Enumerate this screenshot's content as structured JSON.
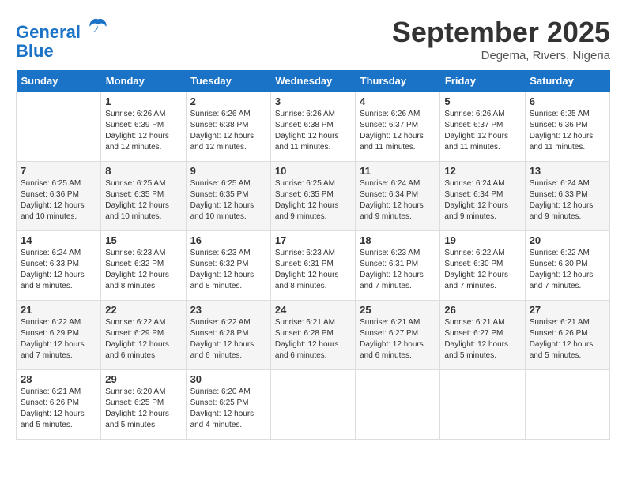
{
  "header": {
    "logo_line1": "General",
    "logo_line2": "Blue",
    "month": "September 2025",
    "location": "Degema, Rivers, Nigeria"
  },
  "days_of_week": [
    "Sunday",
    "Monday",
    "Tuesday",
    "Wednesday",
    "Thursday",
    "Friday",
    "Saturday"
  ],
  "weeks": [
    [
      {
        "day": "",
        "info": ""
      },
      {
        "day": "1",
        "info": "Sunrise: 6:26 AM\nSunset: 6:39 PM\nDaylight: 12 hours\nand 12 minutes."
      },
      {
        "day": "2",
        "info": "Sunrise: 6:26 AM\nSunset: 6:38 PM\nDaylight: 12 hours\nand 12 minutes."
      },
      {
        "day": "3",
        "info": "Sunrise: 6:26 AM\nSunset: 6:38 PM\nDaylight: 12 hours\nand 11 minutes."
      },
      {
        "day": "4",
        "info": "Sunrise: 6:26 AM\nSunset: 6:37 PM\nDaylight: 12 hours\nand 11 minutes."
      },
      {
        "day": "5",
        "info": "Sunrise: 6:26 AM\nSunset: 6:37 PM\nDaylight: 12 hours\nand 11 minutes."
      },
      {
        "day": "6",
        "info": "Sunrise: 6:25 AM\nSunset: 6:36 PM\nDaylight: 12 hours\nand 11 minutes."
      }
    ],
    [
      {
        "day": "7",
        "info": "Sunrise: 6:25 AM\nSunset: 6:36 PM\nDaylight: 12 hours\nand 10 minutes."
      },
      {
        "day": "8",
        "info": "Sunrise: 6:25 AM\nSunset: 6:35 PM\nDaylight: 12 hours\nand 10 minutes."
      },
      {
        "day": "9",
        "info": "Sunrise: 6:25 AM\nSunset: 6:35 PM\nDaylight: 12 hours\nand 10 minutes."
      },
      {
        "day": "10",
        "info": "Sunrise: 6:25 AM\nSunset: 6:35 PM\nDaylight: 12 hours\nand 9 minutes."
      },
      {
        "day": "11",
        "info": "Sunrise: 6:24 AM\nSunset: 6:34 PM\nDaylight: 12 hours\nand 9 minutes."
      },
      {
        "day": "12",
        "info": "Sunrise: 6:24 AM\nSunset: 6:34 PM\nDaylight: 12 hours\nand 9 minutes."
      },
      {
        "day": "13",
        "info": "Sunrise: 6:24 AM\nSunset: 6:33 PM\nDaylight: 12 hours\nand 9 minutes."
      }
    ],
    [
      {
        "day": "14",
        "info": "Sunrise: 6:24 AM\nSunset: 6:33 PM\nDaylight: 12 hours\nand 8 minutes."
      },
      {
        "day": "15",
        "info": "Sunrise: 6:23 AM\nSunset: 6:32 PM\nDaylight: 12 hours\nand 8 minutes."
      },
      {
        "day": "16",
        "info": "Sunrise: 6:23 AM\nSunset: 6:32 PM\nDaylight: 12 hours\nand 8 minutes."
      },
      {
        "day": "17",
        "info": "Sunrise: 6:23 AM\nSunset: 6:31 PM\nDaylight: 12 hours\nand 8 minutes."
      },
      {
        "day": "18",
        "info": "Sunrise: 6:23 AM\nSunset: 6:31 PM\nDaylight: 12 hours\nand 7 minutes."
      },
      {
        "day": "19",
        "info": "Sunrise: 6:22 AM\nSunset: 6:30 PM\nDaylight: 12 hours\nand 7 minutes."
      },
      {
        "day": "20",
        "info": "Sunrise: 6:22 AM\nSunset: 6:30 PM\nDaylight: 12 hours\nand 7 minutes."
      }
    ],
    [
      {
        "day": "21",
        "info": "Sunrise: 6:22 AM\nSunset: 6:29 PM\nDaylight: 12 hours\nand 7 minutes."
      },
      {
        "day": "22",
        "info": "Sunrise: 6:22 AM\nSunset: 6:29 PM\nDaylight: 12 hours\nand 6 minutes."
      },
      {
        "day": "23",
        "info": "Sunrise: 6:22 AM\nSunset: 6:28 PM\nDaylight: 12 hours\nand 6 minutes."
      },
      {
        "day": "24",
        "info": "Sunrise: 6:21 AM\nSunset: 6:28 PM\nDaylight: 12 hours\nand 6 minutes."
      },
      {
        "day": "25",
        "info": "Sunrise: 6:21 AM\nSunset: 6:27 PM\nDaylight: 12 hours\nand 6 minutes."
      },
      {
        "day": "26",
        "info": "Sunrise: 6:21 AM\nSunset: 6:27 PM\nDaylight: 12 hours\nand 5 minutes."
      },
      {
        "day": "27",
        "info": "Sunrise: 6:21 AM\nSunset: 6:26 PM\nDaylight: 12 hours\nand 5 minutes."
      }
    ],
    [
      {
        "day": "28",
        "info": "Sunrise: 6:21 AM\nSunset: 6:26 PM\nDaylight: 12 hours\nand 5 minutes."
      },
      {
        "day": "29",
        "info": "Sunrise: 6:20 AM\nSunset: 6:25 PM\nDaylight: 12 hours\nand 5 minutes."
      },
      {
        "day": "30",
        "info": "Sunrise: 6:20 AM\nSunset: 6:25 PM\nDaylight: 12 hours\nand 4 minutes."
      },
      {
        "day": "",
        "info": ""
      },
      {
        "day": "",
        "info": ""
      },
      {
        "day": "",
        "info": ""
      },
      {
        "day": "",
        "info": ""
      }
    ]
  ]
}
